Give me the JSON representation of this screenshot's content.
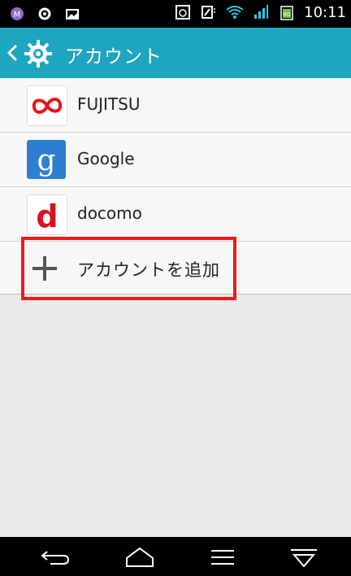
{
  "status_bar": {
    "time": "10:11",
    "left_icons": [
      "app-notification-icon",
      "gear-notification-icon",
      "image-notification-icon"
    ],
    "right_icons": [
      "alarm-icon",
      "nfc-icon",
      "wifi-icon",
      "signal-icon",
      "battery-icon"
    ],
    "battery_level": "80"
  },
  "action_bar": {
    "title": "アカウント",
    "color": "#1ea5bf"
  },
  "accounts": [
    {
      "label": "FUJITSU",
      "icon": "fujitsu-logo-icon"
    },
    {
      "label": "Google",
      "icon": "google-logo-icon"
    },
    {
      "label": "docomo",
      "icon": "docomo-logo-icon"
    }
  ],
  "add_account": {
    "label": "アカウントを追加",
    "icon": "plus-icon",
    "highlight_color": "#ee1a1a"
  },
  "nav_bar": {
    "buttons": [
      "back-icon",
      "home-icon",
      "menu-icon",
      "hide-icon"
    ]
  }
}
